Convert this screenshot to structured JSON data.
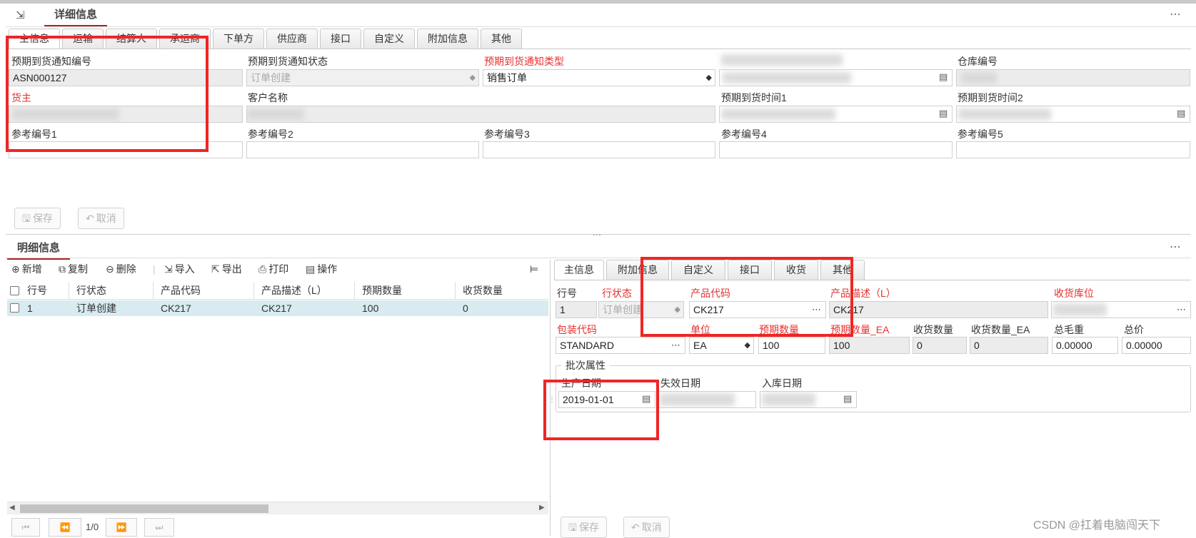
{
  "header": {
    "title": "详细信息",
    "tabs": [
      "主信息",
      "运输",
      "结算人",
      "承运商",
      "下单方",
      "供应商",
      "接口",
      "自定义",
      "附加信息",
      "其他"
    ]
  },
  "asn": {
    "fields": {
      "asn_no_label": "预期到货通知编号",
      "asn_no_value": "ASN000127",
      "status_label": "预期到货通知状态",
      "status_value": "订单创建",
      "type_label": "预期到货通知类型",
      "type_value": "销售订单",
      "warehouse_label": "仓库编号",
      "owner_label": "货主",
      "customer_label": "客户名称",
      "arrival_time1_label": "预期到货时间1",
      "arrival_time2_label": "预期到货时间2",
      "ref1_label": "参考编号1",
      "ref2_label": "参考编号2",
      "ref3_label": "参考编号3",
      "ref4_label": "参考编号4",
      "ref5_label": "参考编号5"
    },
    "buttons": {
      "save": "保存",
      "cancel": "取消"
    }
  },
  "detail": {
    "title": "明细信息",
    "toolbar": {
      "add": "新增",
      "copy": "复制",
      "delete": "删除",
      "import": "导入",
      "export": "导出",
      "print": "打印",
      "operate": "操作"
    },
    "grid": {
      "columns": [
        "行号",
        "行状态",
        "产品代码",
        "产品描述（L）",
        "预期数量",
        "收货数量"
      ],
      "rows": [
        {
          "line": "1",
          "status": "订单创建",
          "sku": "CK217",
          "desc": "CK217",
          "expected": "100",
          "received": "0"
        }
      ]
    },
    "pager": {
      "text": "1/0"
    }
  },
  "line_form": {
    "tabs": [
      "主信息",
      "附加信息",
      "自定义",
      "接口",
      "收货",
      "其他"
    ],
    "fields": {
      "line_no_label": "行号",
      "line_no_value": "1",
      "line_status_label": "行状态",
      "line_status_value": "订单创建",
      "sku_label": "产品代码",
      "sku_value": "CK217",
      "desc_label": "产品描述（L）",
      "desc_value": "CK217",
      "location_label": "收货库位",
      "pack_label": "包装代码",
      "pack_value": "STANDARD",
      "uom_label": "单位",
      "uom_value": "EA",
      "qty_label": "预期数量",
      "qty_value": "100",
      "qty_ea_label": "预期数量_EA",
      "qty_ea_value": "100",
      "recv_label": "收货数量",
      "recv_value": "0",
      "recv_ea_label": "收货数量_EA",
      "recv_ea_value": "0",
      "gross_label": "总毛重",
      "gross_value": "0.00000",
      "price_label": "总价",
      "price_value": "0.00000"
    },
    "batch": {
      "legend": "批次属性",
      "prod_date_label": "生产日期",
      "prod_date_value": "2019-01-01",
      "exp_date_label": "失效日期",
      "in_date_label": "入库日期"
    },
    "buttons": {
      "save": "保存",
      "cancel": "取消"
    }
  },
  "watermark": "CSDN @扛着电脑闯天下",
  "colors": {
    "required": "#e5312f",
    "highlight": "#f02525",
    "selected_row": "#d7ebf0"
  }
}
